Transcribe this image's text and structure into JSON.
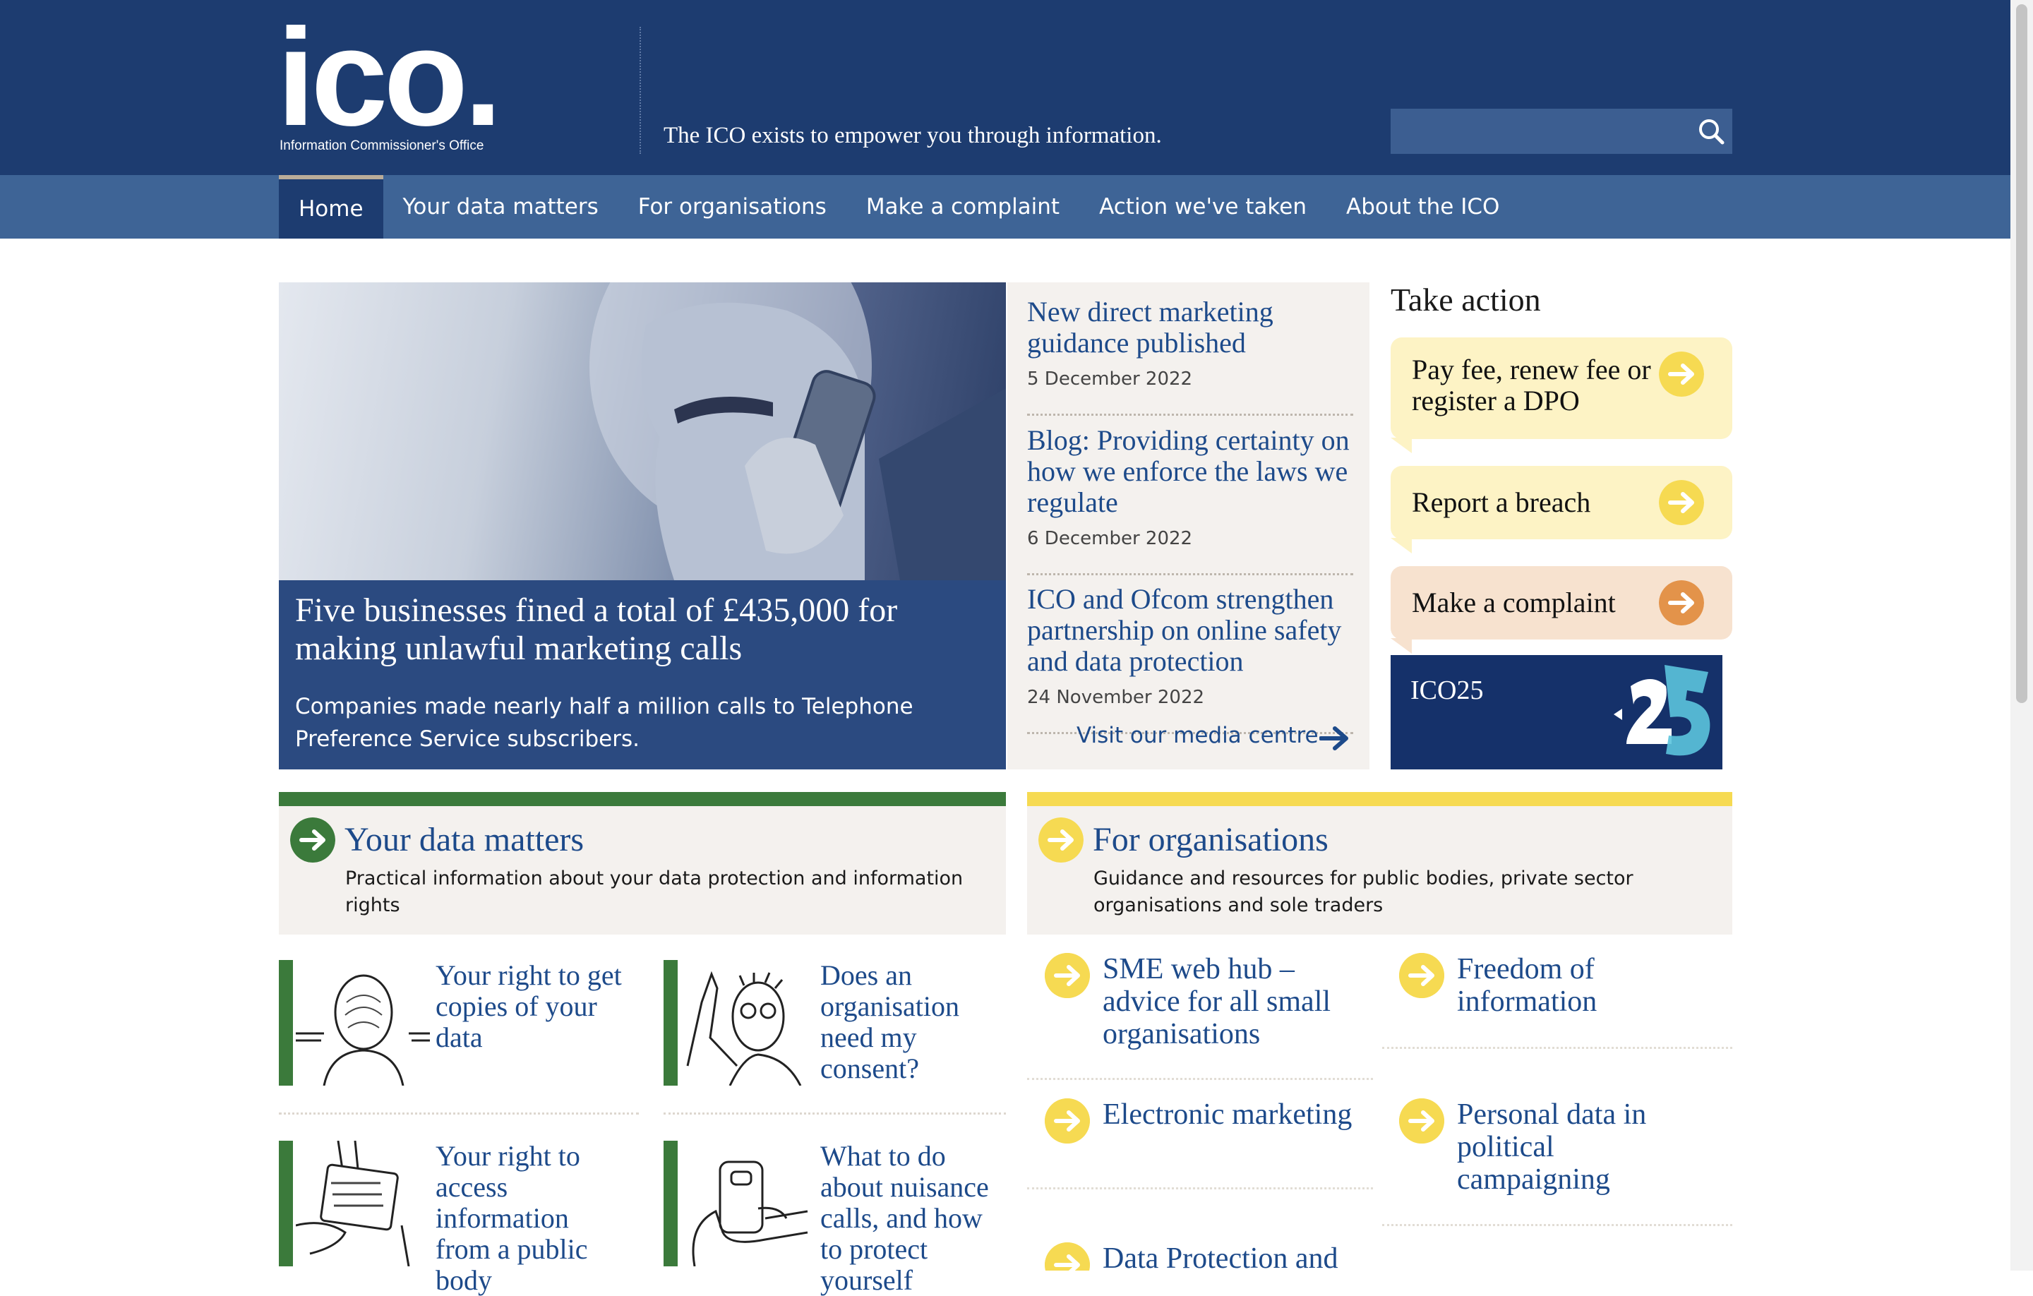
{
  "header": {
    "logo_word": "ico.",
    "logo_sub": "Information Commissioner's Office",
    "tagline": "The ICO exists to empower you through information.",
    "search_placeholder": ""
  },
  "nav": {
    "items": [
      "Home",
      "Your data matters",
      "For organisations",
      "Make a complaint",
      "Action we've taken",
      "About the ICO"
    ],
    "active": "Home"
  },
  "hero": {
    "title": "Five businesses fined a total of £435,000 for making unlawful marketing calls",
    "subtitle": "Companies made nearly half a million calls to Telephone Preference Service subscribers."
  },
  "news": {
    "items": [
      {
        "title": "New direct marketing guidance published",
        "date": "5 December 2022"
      },
      {
        "title": "Blog: Providing certainty on how we enforce the laws we regulate",
        "date": "6 December 2022"
      },
      {
        "title": "ICO and Ofcom strengthen partnership on online safety and data protection",
        "date": "24 November 2022"
      }
    ],
    "media_link": "Visit our media centre"
  },
  "take_action": {
    "heading": "Take action",
    "cards": [
      {
        "label": "Pay fee, renew fee or register a DPO",
        "color": "#fdf3c5",
        "icon_color": "#f6da52"
      },
      {
        "label": "Report a breach",
        "color": "#fdf3c5",
        "icon_color": "#f6da52"
      },
      {
        "label": "Make a complaint",
        "color": "#f7e2cf",
        "icon_color": "#e3934a"
      }
    ],
    "ico25_label": "ICO25"
  },
  "your_data_matters": {
    "title": "Your data matters",
    "description": "Practical information about your data protection and information rights",
    "accent": "#3b7a3b",
    "cards": [
      "Your right to get copies of your data",
      "Does an organisation need my consent?",
      "Your right to access information from a public body",
      "What to do about nuisance calls, and how to protect yourself"
    ]
  },
  "for_organisations": {
    "title": "For organisations",
    "description": "Guidance and resources for public bodies, private sector organisations and sole traders",
    "accent": "#f6da52",
    "links": [
      "SME web hub – advice for all small organisations",
      "Freedom of information",
      "Electronic marketing",
      "Personal data in political campaigning",
      "Data Protection and"
    ]
  }
}
